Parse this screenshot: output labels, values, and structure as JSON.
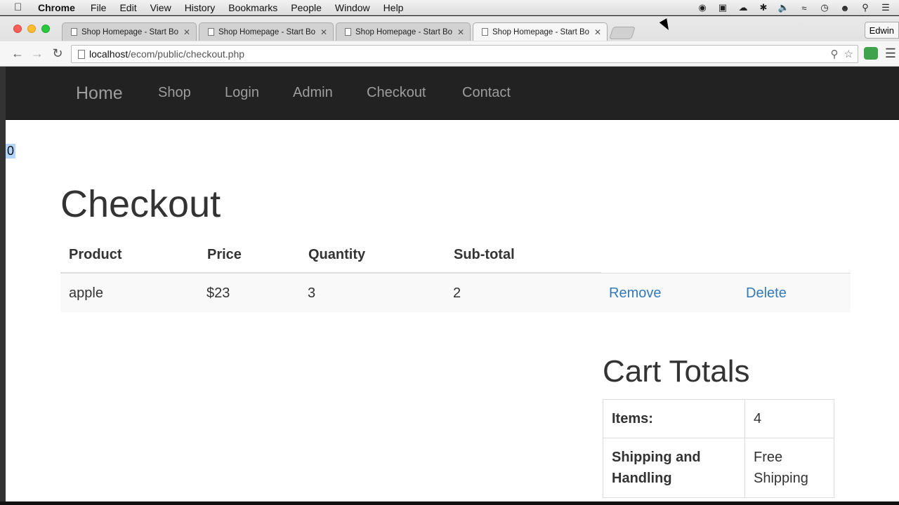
{
  "macos_menu": {
    "app": "Chrome",
    "items": [
      "File",
      "Edit",
      "View",
      "History",
      "Bookmarks",
      "People",
      "Window",
      "Help"
    ]
  },
  "browser": {
    "tabs": [
      {
        "title": "Shop Homepage - Start Bo",
        "active": false
      },
      {
        "title": "Shop Homepage - Start Bo",
        "active": false
      },
      {
        "title": "Shop Homepage - Start Bo",
        "active": false
      },
      {
        "title": "Shop Homepage - Start Bo",
        "active": true
      }
    ],
    "profile_name": "Edwin",
    "url_host": "localhost",
    "url_path": "/ecom/public/checkout.php"
  },
  "site_nav": {
    "brand": "Home",
    "links": [
      "Shop",
      "Login",
      "Admin",
      "Checkout",
      "Contact"
    ]
  },
  "selected_text": "0",
  "page": {
    "title": "Checkout",
    "table_headers": [
      "Product",
      "Price",
      "Quantity",
      "Sub-total"
    ],
    "rows": [
      {
        "product": "apple",
        "price": "$23",
        "quantity": "3",
        "subtotal": "2",
        "remove_label": "Remove",
        "delete_label": "Delete"
      }
    ]
  },
  "cart_totals": {
    "title": "Cart Totals",
    "rows": [
      {
        "label": "Items:",
        "value": "4"
      },
      {
        "label": "Shipping and Handling",
        "value": "Free Shipping"
      }
    ]
  },
  "colors": {
    "navbar_bg": "#222222",
    "link": "#337ab7",
    "selection": "#b4d5fe"
  }
}
